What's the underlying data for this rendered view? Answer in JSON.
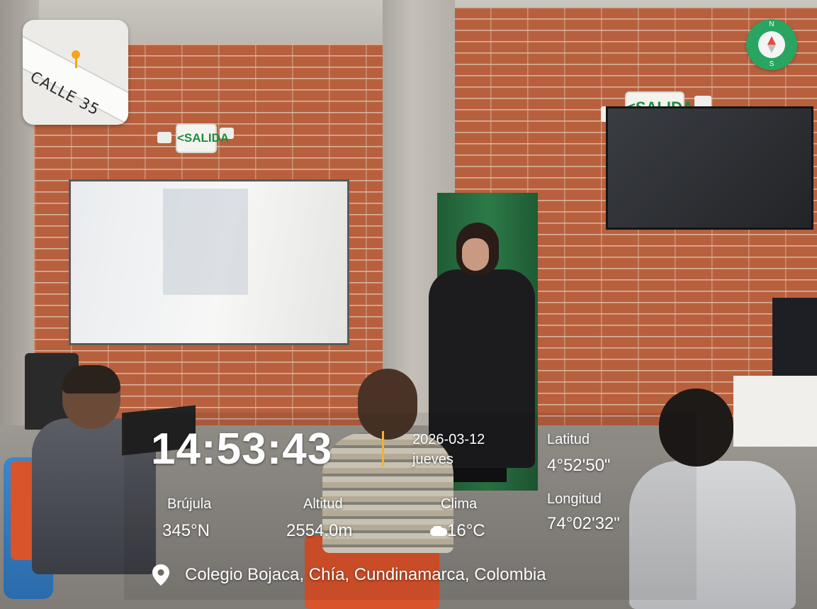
{
  "map": {
    "street_label": "CALLE 35"
  },
  "signs": {
    "exit_left": "<SALIDA",
    "exit_right": "<SALIDA"
  },
  "compass": {
    "north": "N",
    "south": "S"
  },
  "overlay": {
    "time": "14:53:43",
    "date": "2026-03-12",
    "weekday": "jueves",
    "latitude_label": "Latitud",
    "latitude_value": "4°52'50\"",
    "longitude_label": "Longitud",
    "longitude_value": "74°02'32\"",
    "compass_label": "Brújula",
    "compass_value": "345°N",
    "altitude_label": "Altitud",
    "altitude_value": "2554.0m",
    "weather_label": "Clima",
    "weather_value": "16°C",
    "weather_icon": "cloud-icon",
    "address_icon": "location-pin-icon",
    "address": "Colegio Bojaca, Chía, Cundinamarca, Colombia",
    "accent_color": "#f2b233"
  }
}
